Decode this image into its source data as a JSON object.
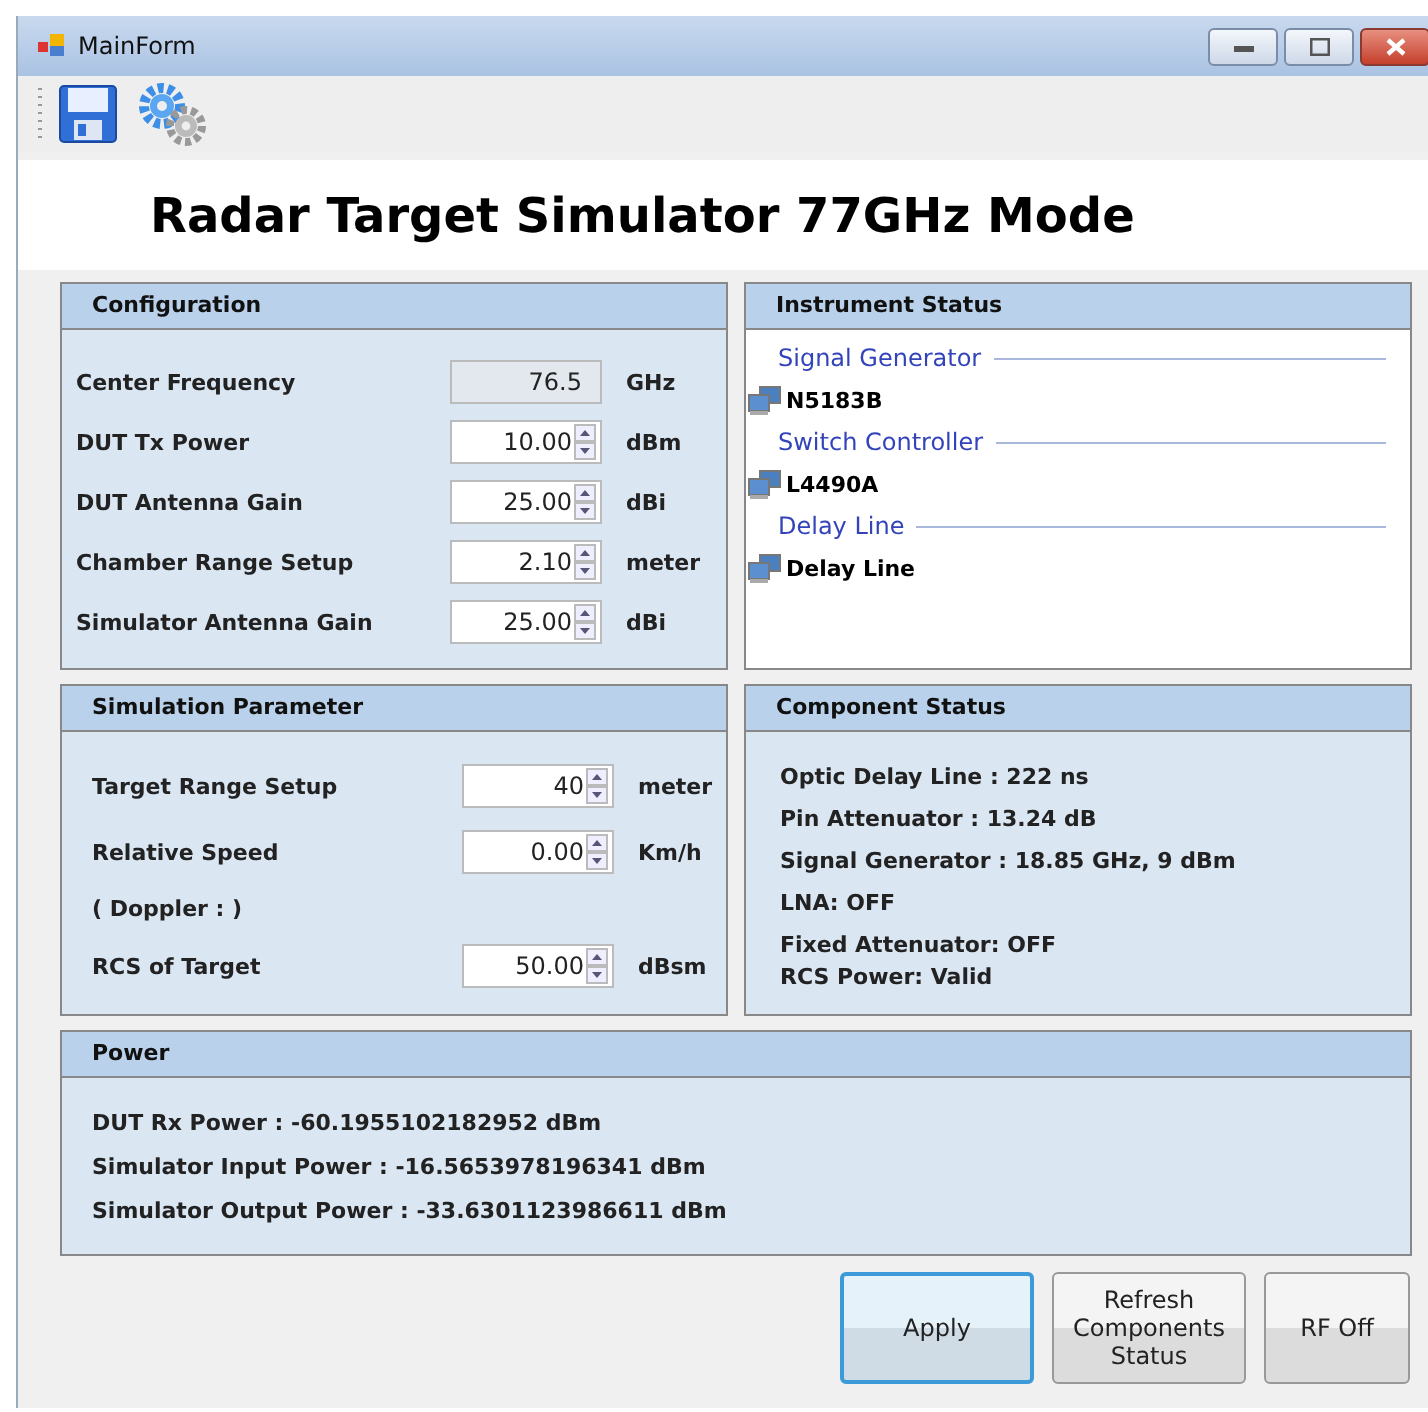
{
  "window": {
    "title": "MainForm"
  },
  "heading": "Radar Target Simulator 77GHz Mode",
  "configuration": {
    "title": "Configuration",
    "fields": [
      {
        "label": "Center Frequency",
        "value": "76.5",
        "unit": "GHz",
        "readonly": true
      },
      {
        "label": "DUT Tx Power",
        "value": "10.00",
        "unit": "dBm",
        "readonly": false
      },
      {
        "label": "DUT Antenna Gain",
        "value": "25.00",
        "unit": "dBi",
        "readonly": false
      },
      {
        "label": "Chamber Range Setup",
        "value": "2.10",
        "unit": "meter",
        "readonly": false
      },
      {
        "label": "Simulator Antenna Gain",
        "value": "25.00",
        "unit": "dBi",
        "readonly": false
      }
    ]
  },
  "instrument_status": {
    "title": "Instrument Status",
    "groups": [
      {
        "label": "Signal Generator",
        "device": "N5183B"
      },
      {
        "label": "Switch Controller",
        "device": "L4490A"
      },
      {
        "label": "Delay Line",
        "device": "Delay Line"
      }
    ]
  },
  "simulation_parameter": {
    "title": "Simulation Parameter",
    "rows": [
      {
        "kind": "field",
        "label": "Target Range Setup",
        "value": "40",
        "unit": "meter"
      },
      {
        "kind": "field",
        "label": "Relative Speed",
        "value": "0.00",
        "unit": "Km/h"
      },
      {
        "kind": "note",
        "label": "( Doppler : )"
      },
      {
        "kind": "field",
        "label": "RCS of Target",
        "value": "50.00",
        "unit": "dBsm"
      }
    ]
  },
  "component_status": {
    "title": "Component Status",
    "lines": [
      "Optic Delay Line : 222 ns",
      "Pin Attenuator : 13.24 dB",
      "Signal Generator : 18.85 GHz,  9 dBm",
      "LNA: OFF",
      "Fixed Attenuator: OFF",
      "RCS Power: Valid"
    ]
  },
  "power": {
    "title": "Power",
    "lines": [
      "DUT Rx Power : -60.1955102182952 dBm",
      "Simulator Input Power : -16.5653978196341 dBm",
      "Simulator Output Power : -33.6301123986611 dBm"
    ]
  },
  "buttons": [
    {
      "label": "Apply",
      "focused": true
    },
    {
      "label": "Refresh Components Status",
      "focused": false
    },
    {
      "label": "RF Off",
      "focused": false
    }
  ]
}
